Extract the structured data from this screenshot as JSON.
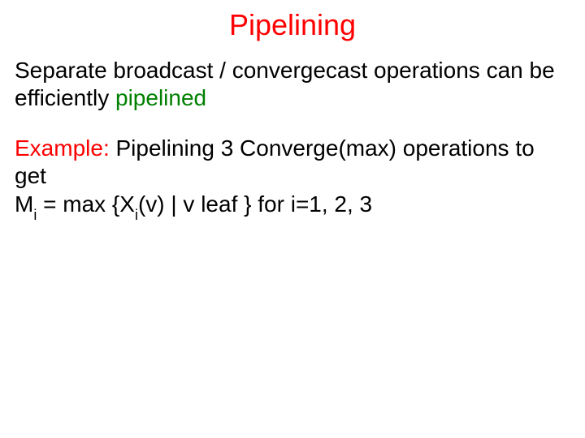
{
  "colors": {
    "red": "#ff0000",
    "green": "#008000",
    "text": "#000000"
  },
  "title": "Pipelining",
  "p1_a": "Separate broadcast / convergecast operations can be efficiently ",
  "p1_b": "pipelined",
  "p2_a": "Example:",
  "p2_b": " Pipelining 3 Converge(max) operations to get",
  "p3_a": "M",
  "p3_b": "i",
  "p3_c": " = max {X",
  "p3_d": "i",
  "p3_e": "(v) | v leaf }  for i=1, 2, 3"
}
